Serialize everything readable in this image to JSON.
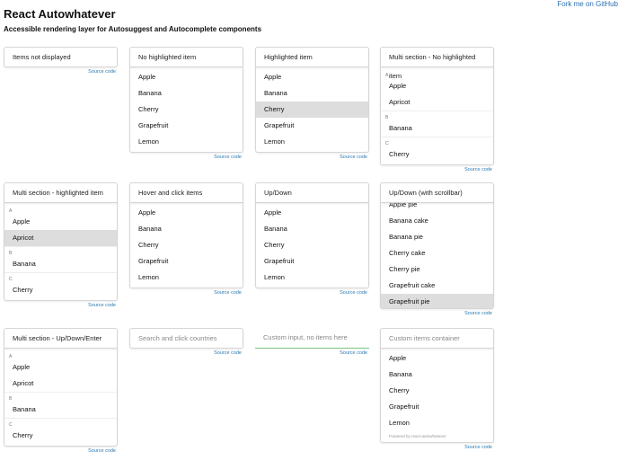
{
  "title": "React Autowhatever",
  "subtitle": "Accessible rendering layer for Autosuggest and Autocomplete components",
  "fork_link": "Fork me on GitHub",
  "source_label": "Source code",
  "colors": {
    "link": "#2a7ab0",
    "highlight": "#dddddd",
    "custom_input_underline": "#7bc47f"
  },
  "examples": [
    {
      "input": "Items not displayed",
      "placeholder": false,
      "items": []
    },
    {
      "input": "No highlighted item",
      "placeholder": false,
      "items": [
        "Apple",
        "Banana",
        "Cherry",
        "Grapefruit",
        "Lemon"
      ]
    },
    {
      "input": "Highlighted item",
      "placeholder": false,
      "items": [
        "Apple",
        "Banana",
        "Cherry",
        "Grapefruit",
        "Lemon"
      ],
      "highlighted": "Cherry"
    },
    {
      "input": "Multi section - No highlighted item",
      "placeholder": false,
      "sections": [
        {
          "title": "A",
          "items": [
            "Apple",
            "Apricot"
          ]
        },
        {
          "title": "B",
          "items": [
            "Banana"
          ]
        },
        {
          "title": "C",
          "items": [
            "Cherry"
          ]
        }
      ]
    },
    {
      "input": "Multi section - highlighted item",
      "placeholder": false,
      "sections": [
        {
          "title": "A",
          "items": [
            "Apple",
            "Apricot"
          ]
        },
        {
          "title": "B",
          "items": [
            "Banana"
          ]
        },
        {
          "title": "C",
          "items": [
            "Cherry"
          ]
        }
      ],
      "highlighted": "Apricot"
    },
    {
      "input": "Hover and click items",
      "placeholder": false,
      "items": [
        "Apple",
        "Banana",
        "Cherry",
        "Grapefruit",
        "Lemon"
      ]
    },
    {
      "input": "Up/Down",
      "placeholder": false,
      "items": [
        "Apple",
        "Banana",
        "Cherry",
        "Grapefruit",
        "Lemon"
      ]
    },
    {
      "input": "Up/Down (with scrollbar)",
      "placeholder": false,
      "scroll": true,
      "items": [
        "Apple pie",
        "Banana cake",
        "Banana pie",
        "Cherry cake",
        "Cherry pie",
        "Grapefruit cake",
        "Grapefruit pie"
      ],
      "highlighted": "Grapefruit pie"
    },
    {
      "input": "Multi section - Up/Down/Enter",
      "placeholder": false,
      "sections": [
        {
          "title": "A",
          "items": [
            "Apple",
            "Apricot"
          ]
        },
        {
          "title": "B",
          "items": [
            "Banana"
          ]
        },
        {
          "title": "C",
          "items": [
            "Cherry"
          ]
        }
      ]
    },
    {
      "input": "Search and click countries",
      "placeholder": true,
      "items": []
    },
    {
      "input": "Custom input, no items here",
      "placeholder": true,
      "custom": true,
      "items": []
    },
    {
      "input": "Custom items container",
      "placeholder": true,
      "items": [
        "Apple",
        "Banana",
        "Cherry",
        "Grapefruit",
        "Lemon"
      ],
      "footer": "Powered by react-autowhatever"
    }
  ]
}
